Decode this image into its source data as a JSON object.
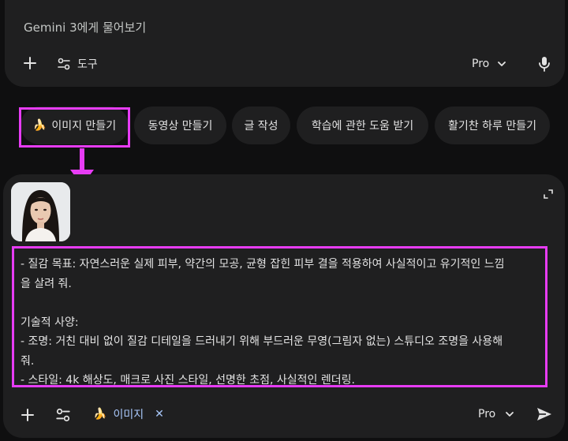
{
  "top_prompt": {
    "placeholder": "Gemini 3에게 물어보기",
    "tools_label": "도구",
    "model_label": "Pro"
  },
  "chips": [
    {
      "icon": "banana-icon",
      "label": "이미지 만들기"
    },
    {
      "label": "동영상 만들기"
    },
    {
      "label": "글 작성"
    },
    {
      "label": "학습에 관한 도움 받기"
    },
    {
      "label": "활기찬 하루 만들기"
    }
  ],
  "composer": {
    "lines": [
      "- 질감 목표: 자연스러운 실제 피부, 약간의 모공, 균형 잡힌 피부 결을 적용하여 사실적이고 유기적인 느낌",
      "을 살려 줘.",
      "",
      "기술적 사양:",
      "- 조명: 거친 대비 없이 질감 디테일을 드러내기 위해 부드러운 무영(그림자 없는) 스튜디오 조명을 사용해",
      "줘.",
      "- 스타일: 4k 해상도, 매크로 사진 스타일, 선명한 초점, 사실적인 렌더링."
    ],
    "image_chip_label": "이미지",
    "image_chip_close": "✕",
    "model_label": "Pro"
  },
  "colors": {
    "highlight": "#e73cf5",
    "panel": "#1f1f20",
    "background": "#0f0f10",
    "accent_blue": "#a8c7fa"
  }
}
